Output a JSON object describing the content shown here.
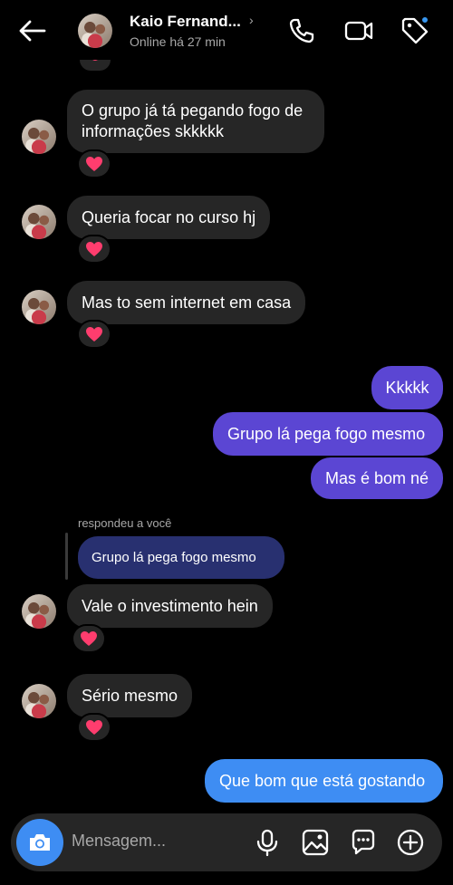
{
  "header": {
    "contact_name": "Kaio Fernand...",
    "chevron": "›",
    "status": "Online há 27 min",
    "icons": [
      "back-arrow-icon",
      "phone-icon",
      "video-camera-icon",
      "tag-icon"
    ]
  },
  "messages": [
    {
      "direction": "in",
      "text_line1": "O grupo já tá pegando fogo de",
      "text_line2": "informações skkkkk",
      "reaction": "❤️"
    },
    {
      "direction": "in",
      "text": "Queria focar no curso hj",
      "reaction": "❤️"
    },
    {
      "direction": "in",
      "text": "Mas to sem internet em casa",
      "reaction": "❤️"
    },
    {
      "direction": "out",
      "text": "Kkkkk"
    },
    {
      "direction": "out",
      "text": "Grupo lá pega fogo mesmo"
    },
    {
      "direction": "out",
      "text": "Mas é bom né"
    },
    {
      "direction": "in",
      "reply_label": "respondeu a você",
      "quoted": "Grupo lá pega fogo mesmo",
      "text": "Vale o investimento hein",
      "reaction": "❤️"
    },
    {
      "direction": "in",
      "text": "Sério mesmo",
      "reaction": "❤️"
    },
    {
      "direction": "out",
      "text": "Que bom que está gostando"
    }
  ],
  "composer": {
    "placeholder": "Mensagem...",
    "icons": [
      "camera-icon",
      "microphone-icon",
      "gallery-icon",
      "sticker-icon",
      "plus-icon"
    ]
  },
  "colors": {
    "background": "#000000",
    "incoming_bubble": "#262626",
    "outgoing_bubble": "#5b46d3",
    "outgoing_latest": "#3e8df3",
    "reply_quote": "#283070"
  }
}
